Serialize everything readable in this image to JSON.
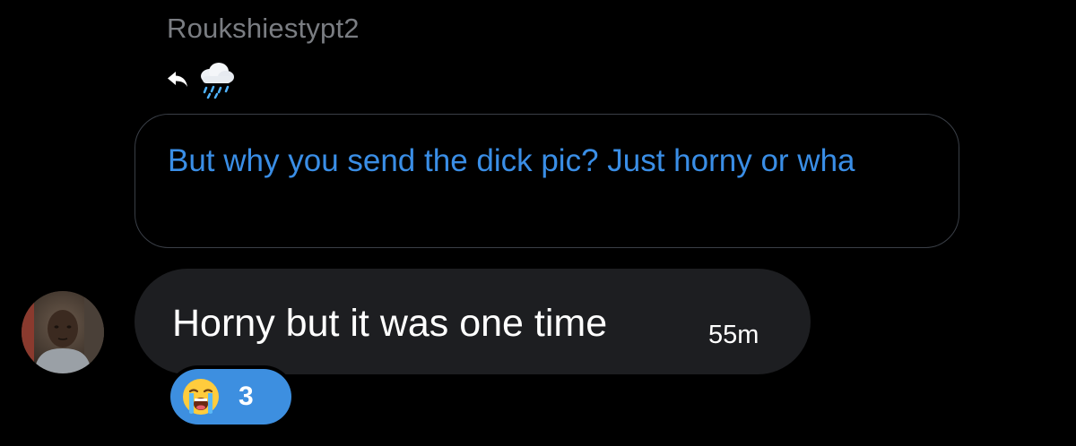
{
  "thread": {
    "sender_name": "Roukshiestypt2",
    "reply": {
      "icon": "reply-arrow-icon",
      "reaction_emoji_icon": "rain-cloud-icon",
      "quoted_text": "But why you send the dick pic? Just horny or wha"
    },
    "message": {
      "avatar": "user-avatar",
      "text": "Horny but it was one time",
      "time": "55m"
    },
    "reaction": {
      "emoji_icon": "loudly-crying-face-icon",
      "count": "3"
    }
  },
  "colors": {
    "background": "#000000",
    "sender_name": "#7a7d82",
    "quoted_text": "#3a8ee6",
    "quoted_border": "#3a3f47",
    "bubble": "#1d1e21",
    "reaction_bg": "#3d8fe0"
  }
}
